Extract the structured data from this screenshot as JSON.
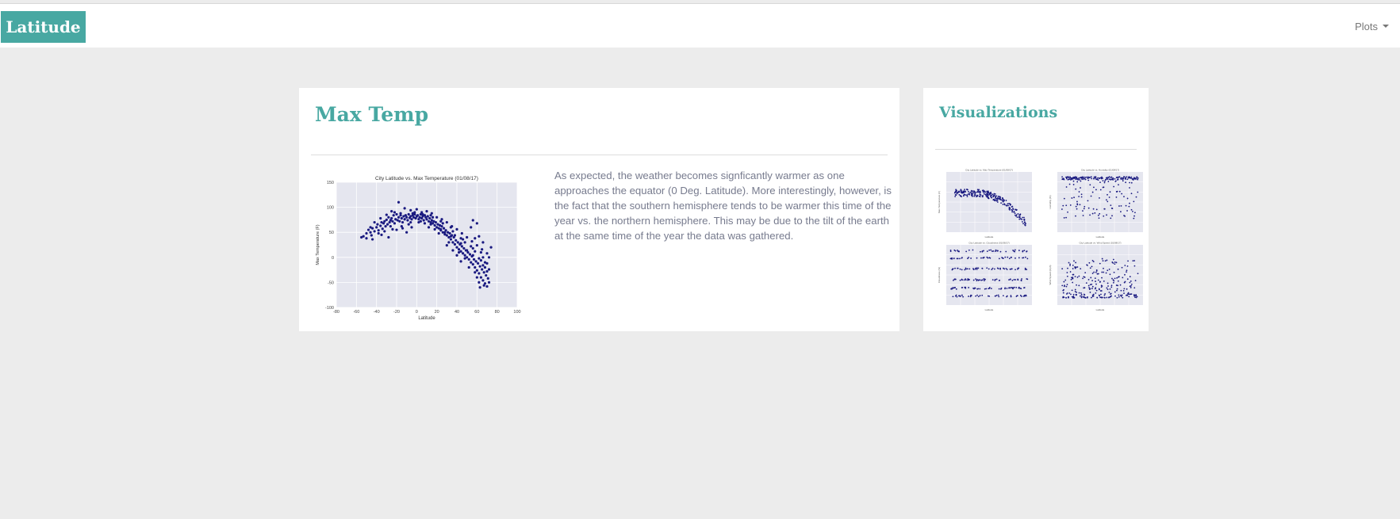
{
  "navbar": {
    "brand": "Latitude",
    "plots_menu": "Plots"
  },
  "main": {
    "title": "Max Temp",
    "description": "As expected, the weather becomes signficantly warmer as one approaches the equator (0 Deg. Latitude). More interestingly, however, is the fact that the southern hemisphere tends to be warmer this time of the year vs. the northern hemisphere. This may be due to the tilt of the earth at the same time of the year the data was gathered."
  },
  "sidebar": {
    "title": "Visualizations",
    "thumbnails": [
      {
        "label": "Max Temp plot",
        "kind": "temp"
      },
      {
        "label": "Humidity plot",
        "kind": "humidity"
      },
      {
        "label": "Cloudiness plot",
        "kind": "cloud"
      },
      {
        "label": "Wind Speed plot",
        "kind": "wind"
      }
    ]
  },
  "chart_data": {
    "type": "scatter",
    "title": "City Latitude vs. Max Temperature (01/08/17)",
    "xlabel": "Latitude",
    "ylabel": "Max Temperature (F)",
    "xlim": [
      -80,
      100
    ],
    "ylim": [
      -100,
      150
    ],
    "xticks": [
      -80,
      -60,
      -40,
      -20,
      0,
      20,
      40,
      60,
      80,
      100
    ],
    "yticks": [
      -100,
      -50,
      0,
      50,
      100,
      150
    ],
    "grid": true,
    "point_color": "#1a1a80",
    "points": [
      [
        -55,
        40
      ],
      [
        -53,
        42
      ],
      [
        -50,
        48
      ],
      [
        -48,
        55
      ],
      [
        -46,
        50
      ],
      [
        -45,
        44
      ],
      [
        -44,
        58
      ],
      [
        -42,
        52
      ],
      [
        -40,
        60
      ],
      [
        -39,
        66
      ],
      [
        -38,
        54
      ],
      [
        -36,
        63
      ],
      [
        -35,
        70
      ],
      [
        -34,
        57
      ],
      [
        -33,
        68
      ],
      [
        -32,
        72
      ],
      [
        -31,
        62
      ],
      [
        -30,
        75
      ],
      [
        -29,
        66
      ],
      [
        -28,
        80
      ],
      [
        -27,
        70
      ],
      [
        -26,
        62
      ],
      [
        -25,
        78
      ],
      [
        -24,
        72
      ],
      [
        -23,
        84
      ],
      [
        -22,
        68
      ],
      [
        -21,
        76
      ],
      [
        -20,
        86
      ],
      [
        -19,
        74
      ],
      [
        -18,
        80
      ],
      [
        -17,
        72
      ],
      [
        -16,
        88
      ],
      [
        -15,
        78
      ],
      [
        -14,
        70
      ],
      [
        -13,
        82
      ],
      [
        -12,
        76
      ],
      [
        -11,
        84
      ],
      [
        -10,
        80
      ],
      [
        -9,
        74
      ],
      [
        -8,
        86
      ],
      [
        -7,
        79
      ],
      [
        -6,
        82
      ],
      [
        -5,
        76
      ],
      [
        -4,
        84
      ],
      [
        -3,
        80
      ],
      [
        -2,
        86
      ],
      [
        -1,
        78
      ],
      [
        0,
        82
      ],
      [
        1,
        84
      ],
      [
        2,
        76
      ],
      [
        3,
        80
      ],
      [
        4,
        86
      ],
      [
        5,
        78
      ],
      [
        6,
        82
      ],
      [
        7,
        74
      ],
      [
        8,
        84
      ],
      [
        9,
        80
      ],
      [
        10,
        76
      ],
      [
        11,
        82
      ],
      [
        12,
        72
      ],
      [
        13,
        78
      ],
      [
        14,
        70
      ],
      [
        15,
        74
      ],
      [
        16,
        68
      ],
      [
        17,
        72
      ],
      [
        18,
        64
      ],
      [
        19,
        70
      ],
      [
        20,
        60
      ],
      [
        21,
        66
      ],
      [
        22,
        58
      ],
      [
        23,
        64
      ],
      [
        24,
        54
      ],
      [
        25,
        62
      ],
      [
        26,
        50
      ],
      [
        27,
        58
      ],
      [
        28,
        46
      ],
      [
        29,
        54
      ],
      [
        30,
        44
      ],
      [
        31,
        50
      ],
      [
        32,
        40
      ],
      [
        33,
        48
      ],
      [
        34,
        36
      ],
      [
        35,
        44
      ],
      [
        36,
        30
      ],
      [
        37,
        40
      ],
      [
        38,
        26
      ],
      [
        39,
        34
      ],
      [
        40,
        20
      ],
      [
        41,
        30
      ],
      [
        42,
        16
      ],
      [
        43,
        26
      ],
      [
        44,
        12
      ],
      [
        45,
        22
      ],
      [
        46,
        8
      ],
      [
        47,
        18
      ],
      [
        48,
        4
      ],
      [
        49,
        14
      ],
      [
        50,
        0
      ],
      [
        51,
        10
      ],
      [
        52,
        -4
      ],
      [
        53,
        6
      ],
      [
        54,
        -10
      ],
      [
        55,
        2
      ],
      [
        56,
        -14
      ],
      [
        57,
        -4
      ],
      [
        58,
        -20
      ],
      [
        59,
        -8
      ],
      [
        60,
        -26
      ],
      [
        61,
        -12
      ],
      [
        62,
        -32
      ],
      [
        63,
        -18
      ],
      [
        64,
        -40
      ],
      [
        65,
        -24
      ],
      [
        66,
        -46
      ],
      [
        67,
        -30
      ],
      [
        68,
        -52
      ],
      [
        69,
        -36
      ],
      [
        70,
        -58
      ],
      [
        71,
        -42
      ],
      [
        72,
        -50
      ],
      [
        -18,
        110
      ],
      [
        -12,
        98
      ],
      [
        -25,
        92
      ],
      [
        0,
        96
      ],
      [
        10,
        92
      ],
      [
        -30,
        85
      ],
      [
        -6,
        94
      ],
      [
        5,
        90
      ],
      [
        15,
        88
      ],
      [
        20,
        80
      ],
      [
        25,
        76
      ],
      [
        30,
        70
      ],
      [
        35,
        62
      ],
      [
        40,
        56
      ],
      [
        45,
        48
      ],
      [
        50,
        40
      ],
      [
        55,
        32
      ],
      [
        60,
        24
      ],
      [
        65,
        16
      ],
      [
        70,
        8
      ],
      [
        -20,
        55
      ],
      [
        -10,
        50
      ],
      [
        -35,
        45
      ],
      [
        -28,
        40
      ],
      [
        -5,
        60
      ],
      [
        12,
        60
      ],
      [
        22,
        48
      ],
      [
        32,
        30
      ],
      [
        42,
        10
      ],
      [
        52,
        -20
      ],
      [
        58,
        38
      ],
      [
        62,
        42
      ],
      [
        66,
        30
      ],
      [
        54,
        60
      ],
      [
        60,
        68
      ],
      [
        56,
        74
      ],
      [
        64,
        10
      ],
      [
        68,
        -10
      ],
      [
        72,
        0
      ],
      [
        74,
        20
      ],
      [
        -15,
        62
      ],
      [
        -8,
        66
      ],
      [
        2,
        70
      ],
      [
        8,
        68
      ],
      [
        18,
        56
      ],
      [
        28,
        50
      ],
      [
        38,
        44
      ],
      [
        48,
        30
      ],
      [
        58,
        12
      ],
      [
        68,
        -20
      ],
      [
        -42,
        70
      ],
      [
        -22,
        90
      ],
      [
        -2,
        90
      ],
      [
        14,
        84
      ],
      [
        24,
        72
      ],
      [
        34,
        60
      ],
      [
        44,
        38
      ],
      [
        54,
        22
      ],
      [
        64,
        -6
      ],
      [
        70,
        -28
      ],
      [
        -46,
        60
      ],
      [
        -36,
        78
      ],
      [
        -26,
        74
      ],
      [
        -16,
        84
      ],
      [
        -4,
        88
      ],
      [
        6,
        86
      ],
      [
        16,
        80
      ],
      [
        26,
        68
      ],
      [
        36,
        52
      ],
      [
        46,
        36
      ],
      [
        56,
        18
      ],
      [
        66,
        0
      ],
      [
        60,
        -40
      ],
      [
        62,
        -50
      ],
      [
        58,
        -30
      ],
      [
        48,
        -2
      ],
      [
        44,
        -8
      ],
      [
        40,
        4
      ],
      [
        36,
        14
      ],
      [
        30,
        24
      ],
      [
        -50,
        38
      ],
      [
        -44,
        36
      ],
      [
        -38,
        48
      ],
      [
        -32,
        52
      ],
      [
        -24,
        56
      ],
      [
        -14,
        58
      ],
      [
        -6,
        70
      ],
      [
        4,
        72
      ],
      [
        14,
        66
      ],
      [
        24,
        56
      ],
      [
        34,
        42
      ],
      [
        44,
        28
      ],
      [
        50,
        14
      ],
      [
        56,
        4
      ],
      [
        62,
        -2
      ],
      [
        66,
        -16
      ],
      [
        70,
        -12
      ],
      [
        72,
        -24
      ],
      [
        63,
        -60
      ],
      [
        67,
        -56
      ]
    ]
  },
  "thumbnails_data": {
    "temp": {
      "title": "City Latitude vs. Max Temperature (01/08/17)",
      "xlabel": "Latitude",
      "ylabel": "Max Temperature (F)"
    },
    "humidity": {
      "title": "City Latitude vs. Humidity (01/08/17)",
      "xlabel": "Latitude",
      "ylabel": "Humidity (%)"
    },
    "cloud": {
      "title": "City Latitude vs. Cloudiness (01/08/17)",
      "xlabel": "Latitude",
      "ylabel": "Cloudiness (%)"
    },
    "wind": {
      "title": "City Latitude vs. Wind Speed (01/08/17)",
      "xlabel": "Latitude",
      "ylabel": "Wind Speed (mph)"
    }
  }
}
